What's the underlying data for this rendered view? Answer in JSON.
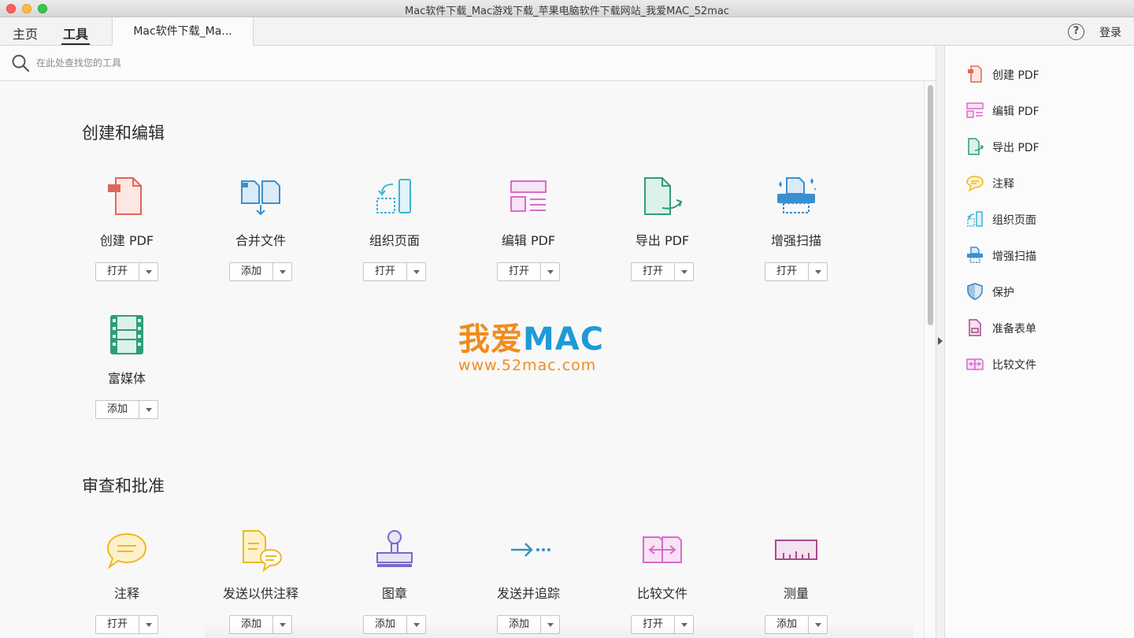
{
  "window": {
    "title": "Mac软件下载_Mac游戏下载_苹果电脑软件下载网站_我爱MAC_52mac"
  },
  "nav": {
    "home": "主页",
    "tools": "工具",
    "doc_tab": "Mac软件下载_Ma...",
    "login": "登录",
    "help": "?"
  },
  "search": {
    "placeholder": "在此处查找您的工具"
  },
  "sections": {
    "create_edit": "创建和编辑",
    "review_approve": "审查和批准"
  },
  "tools": {
    "create_pdf": {
      "label": "创建 PDF",
      "action": "打开"
    },
    "combine": {
      "label": "合并文件",
      "action": "添加"
    },
    "organize": {
      "label": "组织页面",
      "action": "打开"
    },
    "edit_pdf": {
      "label": "编辑 PDF",
      "action": "打开"
    },
    "export_pdf": {
      "label": "导出 PDF",
      "action": "打开"
    },
    "enhance_scan": {
      "label": "增强扫描",
      "action": "打开"
    },
    "rich_media": {
      "label": "富媒体",
      "action": "添加"
    },
    "comment": {
      "label": "注释",
      "action": "打开"
    },
    "send_comment": {
      "label": "发送以供注释",
      "action": "添加"
    },
    "stamp": {
      "label": "图章",
      "action": "添加"
    },
    "send_track": {
      "label": "发送并追踪",
      "action": "添加"
    },
    "compare": {
      "label": "比较文件",
      "action": "打开"
    },
    "measure": {
      "label": "测量",
      "action": "添加"
    }
  },
  "watermark": {
    "cn": "我爱",
    "en": "MAC",
    "url": "www.52mac.com"
  },
  "right_pane": {
    "items": [
      {
        "label": "创建 PDF",
        "icon": "create-pdf-icon"
      },
      {
        "label": "编辑 PDF",
        "icon": "edit-pdf-icon"
      },
      {
        "label": "导出 PDF",
        "icon": "export-pdf-icon"
      },
      {
        "label": "注释",
        "icon": "comment-icon"
      },
      {
        "label": "组织页面",
        "icon": "organize-pages-icon"
      },
      {
        "label": "增强扫描",
        "icon": "enhance-scan-icon"
      },
      {
        "label": "保护",
        "icon": "protect-icon"
      },
      {
        "label": "准备表单",
        "icon": "prepare-form-icon"
      },
      {
        "label": "比较文件",
        "icon": "compare-files-icon"
      }
    ]
  },
  "colors": {
    "create": "#e0665a",
    "combine": "#3a8fd0",
    "organize": "#3cb6d0",
    "edit": "#d86ccc",
    "export": "#2e9e7a",
    "scan": "#3a8fd0",
    "media": "#2e9e7a",
    "comment": "#f0b81e",
    "stamp": "#7b68c8",
    "measure": "#a64a8c",
    "protect": "#3a7fc0",
    "form": "#a64a8c"
  }
}
